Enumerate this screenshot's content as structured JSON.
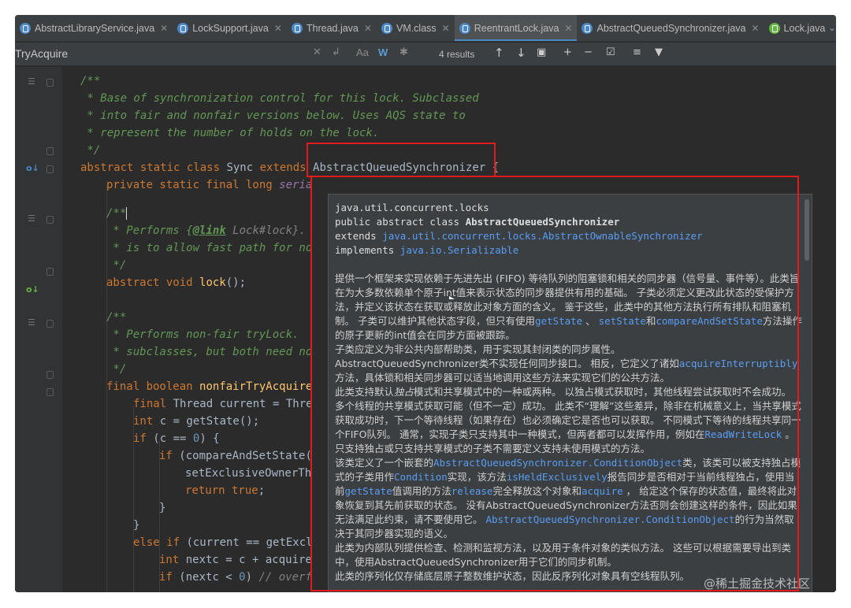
{
  "tabs": [
    {
      "label": "AbstractLibraryService.java",
      "icon": "class-icon",
      "active": false
    },
    {
      "label": "LockSupport.java",
      "icon": "class-icon",
      "active": false
    },
    {
      "label": "Thread.java",
      "icon": "class-icon",
      "active": false
    },
    {
      "label": "VM.class",
      "icon": "class-icon",
      "active": false
    },
    {
      "label": "ReentrantLock.java",
      "icon": "class-icon",
      "active": true
    },
    {
      "label": "AbstractQueuedSynchronizer.java",
      "icon": "class-icon",
      "active": false
    },
    {
      "label": "Lock.java",
      "icon": "interface-icon",
      "active": false
    }
  ],
  "tab_more": "⌄",
  "search": {
    "term": "TryAcquire",
    "results": "4 results",
    "icons": [
      "clear-icon",
      "replace-icon",
      "match-case-icon",
      "whole-words-icon",
      "regex-icon",
      "prev-occurrence-icon",
      "next-occurrence-icon",
      "select-all-icon",
      "add-occurrence-icon",
      "remove-occurrence-icon",
      "select-occurrences-icon",
      "filter-icon",
      "funnel-icon"
    ],
    "match_case": "Aa",
    "whole_words": "W"
  },
  "code": {
    "l1": "/**",
    "l2": " * Base of synchronization control for this lock. Subclassed",
    "l3": " * into fair and nonfair versions below. Uses AQS state to",
    "l4": " * represent the number of holds on the lock.",
    "l5": " */",
    "l6_kw": "abstract static class ",
    "l6_name": "Sync ",
    "l6_ext": "extends ",
    "l6_super": "AbstractQueuedSynchronizer {",
    "l7_kw": "private static final long ",
    "l7_field": "seria",
    "l8": "/**",
    "l9_a": " * Performs {",
    "l9_tag": "@link",
    "l9_b": " Lock#lock}.",
    "l10": " * is to allow fast path for no",
    "l11": " */",
    "l12_kw": "abstract void ",
    "l12_fn": "lock",
    "l12_rest": "();",
    "l13": "/**",
    "l14": " * Performs non-fair tryLock.",
    "l15": " * subclasses, but both need no",
    "l16": " */",
    "l17_kw": "final boolean ",
    "l17_fn": "nonfairTryAcquire",
    "l18_kw": "final ",
    "l18_rest": "Thread current = Thre",
    "l19_kw": "int ",
    "l19_rest": "c = getState();",
    "l20_kw": "if ",
    "l20_a": "(c == ",
    "l20_num": "0",
    "l20_b": ") {",
    "l21_kw": "if ",
    "l21_rest": "(compareAndSetState(",
    "l22": "setExclusiveOwnerTh",
    "l23_kw": "return true",
    "l23_rest": ";",
    "l24": "}",
    "l25": "}",
    "l26_kw": "else if ",
    "l26_rest": "(current == getExcl",
    "l27_kw": "int ",
    "l27_rest": "nextc = c + acquire",
    "l28_kw": "if ",
    "l28_a": "(nextc < ",
    "l28_num": "0",
    "l28_b": ") ",
    "l28_cm": "// overf"
  },
  "popup": {
    "package": "java.util.concurrent.locks",
    "decl_prefix": "public abstract class ",
    "decl_name": "AbstractQueuedSynchronizer",
    "extends_kw": "extends ",
    "extends_link": "java.util.concurrent.locks.AbstractOwnableSynchronizer",
    "implements_kw": "implements ",
    "implements_link": "java.io.Serializable",
    "p1_a": "提供一个框架来实现依赖于先进先出 (FIFO) 等待队列的阻塞锁和相关的同步器（信号量、事件等）。此类旨在为大多数依赖单个原子int值来表示状态的同步器提供有用的基础。 子类必须定义更改此状态的受保护方法，并定义该状态在获取或释放此对象方面的含义。 鉴于这些，此类中的其他方法执行所有排队和阻塞机制。 子类可以维护其他状态字段，但只有使用",
    "p1_l1": "getState",
    "p1_b": " 、 ",
    "p1_l2": "setState",
    "p1_c": "和",
    "p1_l3": "compareAndSetState",
    "p1_d": "方法操作的原子更新的int值会在同步方面被跟踪。",
    "p2": "子类应定义为非公共内部帮助类，用于实现其封闭类的同步属性。",
    "p3_a": "AbstractQueuedSynchronizer类不实现任何同步接口。 相反，它定义了诸如",
    "p3_l1": "acquireInterruptibly",
    "p3_b": "方法，具体锁和相关同步器可以适当地调用这些方法来实现它们的公共方法。",
    "p4_a": "此类支持默认",
    "p4_i1": "独占",
    "p4_b": "模式和共享模式中的一种或两种。 以独占模式获取时，其他线程尝试获取时不会成功。 多个线程的共享模式获取可能（但不一定）成功。 此类不“理解”这些差异，除非在机械意义上，当共享模式获取成功时，下一个等待线程（如果存在）也必须确定它是否也可以获取。 不同模式下等待的线程共享同一个FIFO队列。 通常，实现子类只支持其中一种模式，但两者都可以发挥作用，例如在",
    "p4_l1": "ReadWriteLock",
    "p4_c": " 。 只支持独占或只支持共享模式的子类不需要定义支持未使用模式的方法。",
    "p5_a": "该类定义了一个嵌套的",
    "p5_l1": "AbstractQueuedSynchronizer.ConditionObject",
    "p5_b": "类，该类可以被支持独占模式的子类用作",
    "p5_l2": "Condition",
    "p5_c": "实现，该方法",
    "p5_l3": "isHeldExclusively",
    "p5_d": "报告同步是否相对于当前线程独占，使用当前",
    "p5_l4": "getState",
    "p5_e": "值调用的方法",
    "p5_l5": "release",
    "p5_f": "完全释放这个对象和",
    "p5_l6": "acquire",
    "p5_g": " ， 给定这个保存的状态值，最终将此对象恢复到其先前获取的状态。 没有AbstractQueuedSynchronizer方法否则会创建这样的条件，因此如果无法满足此约束，请不要使用它。 ",
    "p5_l7": "AbstractQueuedSynchronizer.ConditionObject",
    "p5_h": "的行为当然取决于其同步器实现的语义。",
    "p6": "此类为内部队列提供检查、检测和监视方法，以及用于条件对象的类似方法。 这些可以根据需要导出到类中，使用AbstractQueuedSynchronizer用于它们的同步机制。",
    "p7": "此类的序列化仅存储底层原子整数维护状态，因此反序列化对象具有空线程队列。"
  },
  "watermark": "@稀土掘金技术社区",
  "colors": {
    "highlight_box": "#e01b1b",
    "link": "#589df6",
    "keyword": "#cc7832",
    "comment": "#629755"
  }
}
